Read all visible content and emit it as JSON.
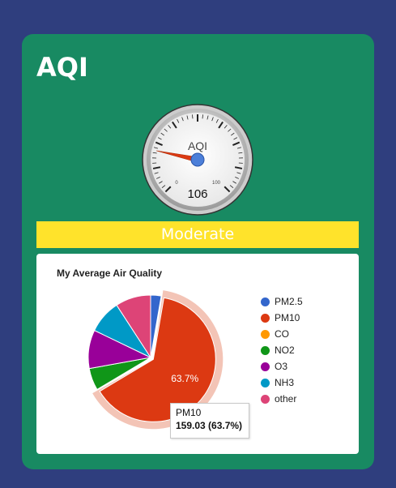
{
  "header": {
    "title": "AQI"
  },
  "gauge": {
    "label": "AQI",
    "value": 106,
    "min": 0,
    "max": 500,
    "min_label": "0",
    "max_label": "100"
  },
  "status": {
    "label": "Moderate",
    "color": "#ffe32b"
  },
  "chart_data": {
    "type": "pie",
    "title": "My Average Air Quality",
    "legend_position": "right",
    "slices": [
      {
        "name": "PM2.5",
        "value": 6.8,
        "color": "#3366cc"
      },
      {
        "name": "PM10",
        "value": 159.03,
        "percent": "63.7%",
        "color": "#dc3912"
      },
      {
        "name": "CO",
        "value": 0,
        "color": "#ff9900"
      },
      {
        "name": "NO2",
        "value": 14.3,
        "color": "#109618"
      },
      {
        "name": "O3",
        "value": 24.9,
        "color": "#990099"
      },
      {
        "name": "NH3",
        "value": 21.7,
        "color": "#0099c6"
      },
      {
        "name": "other",
        "value": 22.9,
        "color": "#dd4477"
      }
    ]
  },
  "tooltip": {
    "name": "PM10",
    "value": "159.03 (63.7%)"
  }
}
